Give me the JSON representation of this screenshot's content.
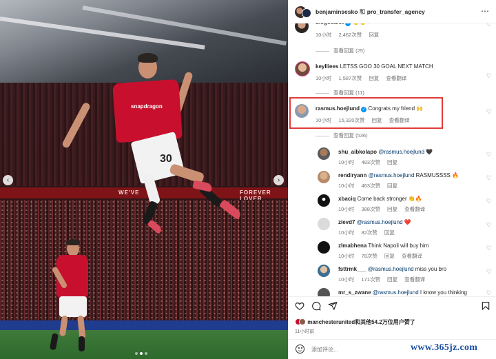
{
  "header": {
    "user1": "benjaminsesko",
    "joiner": "和",
    "user2": "pro_transfer_agency",
    "more_icon": "more-horizontal-icon"
  },
  "photo": {
    "ad_text_left": "WE'VE",
    "ad_text_right": "FOREVER LOVER",
    "shirt_number": "30",
    "sponsor": "snapdragon"
  },
  "comments": [
    {
      "user": "diogodalot",
      "text": "",
      "time": "10小时",
      "likes": "2,462次赞",
      "reply": "回复",
      "view_replies": "查看回复 (25)",
      "tail_emoji": "👏👏❤"
    },
    {
      "user": "keylliees",
      "text": "LETSS GOO 30 GOAL NEXT MATCH",
      "time": "10小时",
      "likes": "1,587次赞",
      "reply": "回复",
      "translate": "查看翻译",
      "view_replies": "查看回复 (11)"
    },
    {
      "user": "rasmus.hoejlund",
      "text": "Congrats my friend",
      "emoji": "🙌",
      "time": "10小时",
      "likes": "15,320次赞",
      "reply": "回复",
      "translate": "查看翻译",
      "view_replies": "查看回复 (536)"
    },
    {
      "user": "shu_aibkolapo",
      "mention": "@rasmus.hoejlund",
      "text": "",
      "emoji": "🖤",
      "time": "10小时",
      "likes": "483次赞",
      "reply": "回复"
    },
    {
      "user": "rendiryann",
      "mention": "@rasmus.hoejlund",
      "text": "RASMUSSSS",
      "emoji": "🔥",
      "time": "10小时",
      "likes": "463次赞",
      "reply": "回复"
    },
    {
      "user": "xbaciq",
      "text": "Come back stronger",
      "emoji": "👏🔥",
      "time": "10小时",
      "likes": "388次赞",
      "reply": "回复",
      "translate": "查看翻译"
    },
    {
      "user": "zievd7",
      "mention": "@rasmus.hoejlund",
      "text": "",
      "emoji": "❤️",
      "time": "10小时",
      "likes": "82次赞",
      "reply": "回复"
    },
    {
      "user": "zlmabhena",
      "text": "Think Napoli will buy him",
      "time": "10小时",
      "likes": "78次赞",
      "reply": "回复",
      "translate": "查看翻译"
    },
    {
      "user": "fsttrmk___",
      "mention": "@rasmus.hoejlund",
      "text": "miss you bro",
      "time": "10小时",
      "likes": "171次赞",
      "reply": "回复",
      "translate": "查看翻译"
    },
    {
      "user": "mr_s_zwane",
      "mention": "@rasmus.hoejlund",
      "text": "I know you thinking"
    }
  ],
  "actions": {
    "like_icon": "heart-icon",
    "comment_icon": "comment-icon",
    "share_icon": "send-icon",
    "save_icon": "bookmark-icon",
    "liked_by": "manchesterunited",
    "liked_suffix": "和其他54.2万位用户赞了",
    "time_ago": "11小时前"
  },
  "compose": {
    "placeholder": "添加评论...",
    "emoji_icon": "smiley-icon"
  },
  "watermark": "www.365jz.com",
  "colors": {
    "accent": "#0095f6",
    "highlight_box": "#e03b3b",
    "kit_red": "#c8102e",
    "secondary_text": "#737373"
  }
}
